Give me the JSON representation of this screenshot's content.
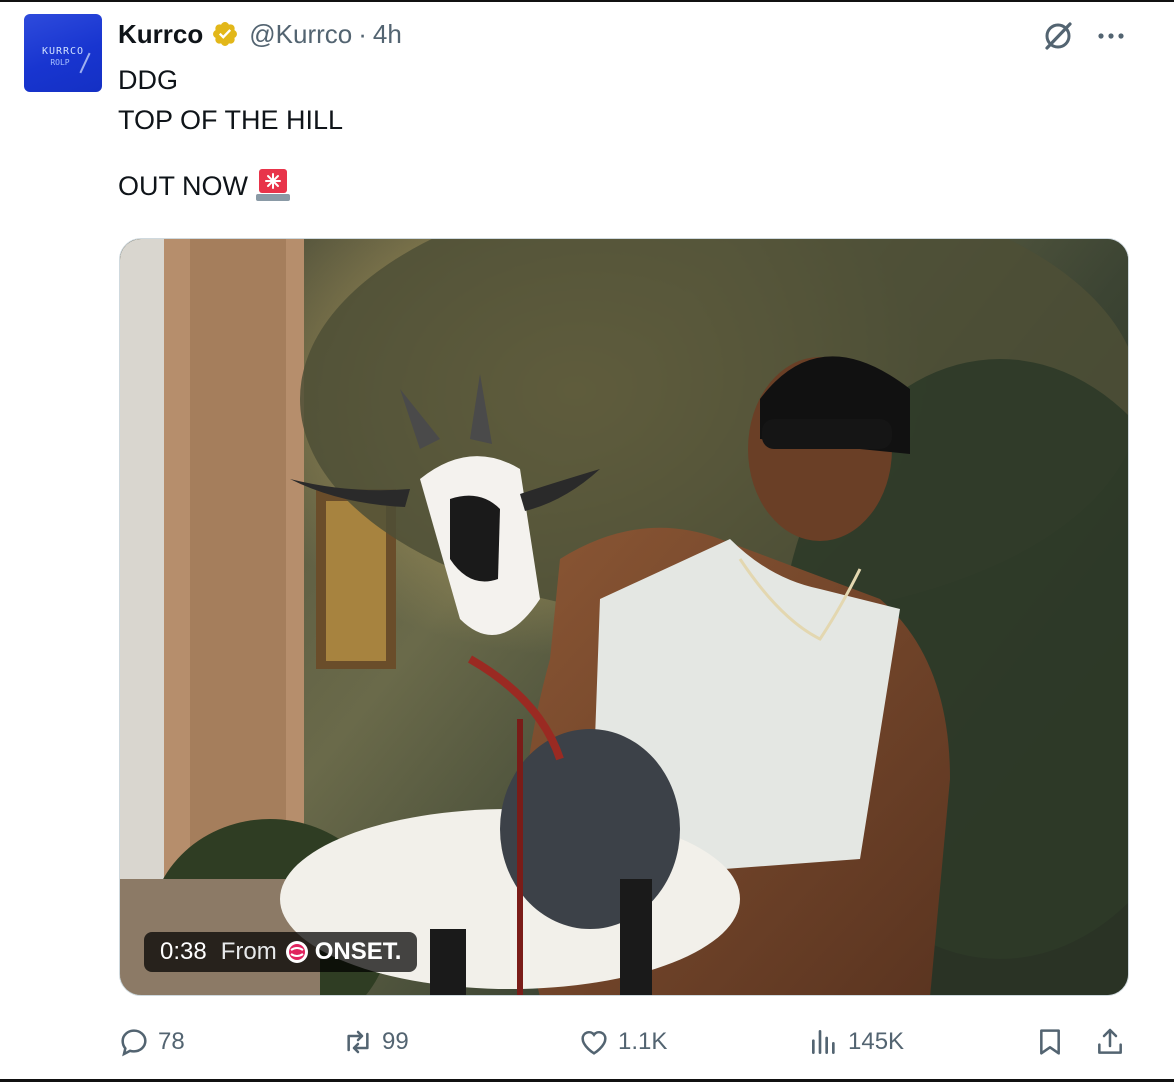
{
  "post": {
    "author_name": "Kurrco",
    "handle": "@Kurrco",
    "separator": "·",
    "time_ago": "4h",
    "verified": true,
    "avatar_text": "KURRCO",
    "avatar_subtext": "ROLP",
    "text_lines": [
      "DDG",
      "TOP OF THE HILL",
      "OUT NOW"
    ],
    "emoji": "siren-icon"
  },
  "header_icons": {
    "grok": "grok-icon",
    "more": "more-icon"
  },
  "media": {
    "type": "video",
    "duration": "0:38",
    "from_label": "From",
    "source_name": "ONSET."
  },
  "actions": {
    "replies": "78",
    "reposts": "99",
    "likes": "1.1K",
    "views": "145K"
  },
  "colors": {
    "text": "#0f1419",
    "secondary": "#536471",
    "verified_gold": "#e2b719",
    "avatar_blue": "#1835d0"
  }
}
